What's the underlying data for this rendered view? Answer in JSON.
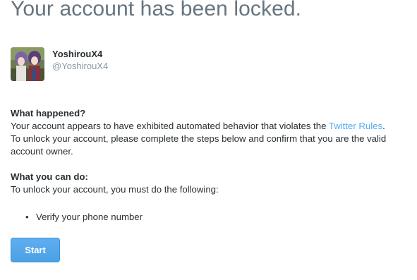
{
  "page": {
    "headline": "Your account has been locked."
  },
  "account": {
    "display_name": "YoshirouX4",
    "screen_name": "@YoshirouX4"
  },
  "what_happened": {
    "heading": "What happened?",
    "line1_prefix": "Your account appears to have exhibited automated behavior that violates the ",
    "rules_link": "Twitter Rules",
    "line1_suffix": ".",
    "line2": "To unlock your account, please complete the steps below and confirm that you are the valid",
    "line3": "account owner."
  },
  "what_you_can_do": {
    "heading": "What you can do:",
    "intro": "To unlock your account, you must do the following:",
    "steps": [
      "Verify your phone number"
    ]
  },
  "actions": {
    "start_label": "Start"
  },
  "colors": {
    "link": "#55acee",
    "button": "#55acee",
    "headline": "#66757f",
    "secondary_text": "#8899a6"
  }
}
